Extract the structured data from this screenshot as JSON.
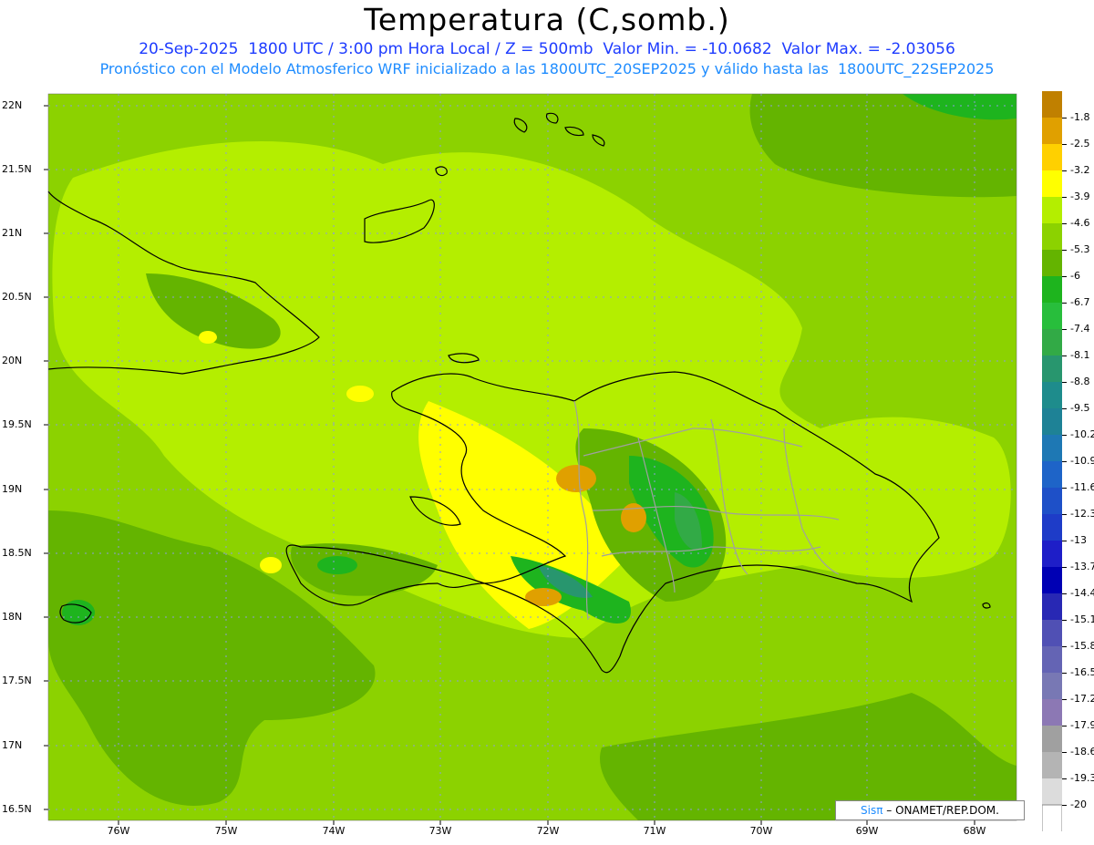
{
  "header": {
    "title": "Temperatura (C,somb.)",
    "subtitle1": "20-Sep-2025  1800 UTC / 3:00 pm Hora Local / Z = 500mb  Valor Min. = -10.0682  Valor Max. = -2.03056",
    "subtitle2": "Pronóstico con el Modelo Atmosferico WRF inicializado a las 1800UTC_20SEP2025 y válido hasta las  1800UTC_22SEP2025"
  },
  "axes": {
    "lat_labels": [
      "22N",
      "21.5N",
      "21N",
      "20.5N",
      "20N",
      "19.5N",
      "19N",
      "18.5N",
      "18N",
      "17.5N",
      "17N",
      "16.5N"
    ],
    "lon_labels": [
      "76W",
      "75W",
      "74W",
      "73W",
      "72W",
      "71W",
      "70W",
      "69W",
      "68W"
    ]
  },
  "colorbar": {
    "labels": [
      "-1.8",
      "-2.5",
      "-3.2",
      "-3.9",
      "-4.6",
      "-5.3",
      "-6",
      "-6.7",
      "-7.4",
      "-8.1",
      "-8.8",
      "-9.5",
      "-10.2",
      "-10.9",
      "-11.6",
      "-12.3",
      "-13",
      "-13.7",
      "-14.4",
      "-15.1",
      "-15.8",
      "-16.5",
      "-17.2",
      "-17.9",
      "-18.6",
      "-19.3",
      "-20"
    ],
    "colors": [
      "#c08000",
      "#e0a000",
      "#ffd000",
      "#ffff00",
      "#b4ee00",
      "#8cd200",
      "#64b400",
      "#1eb41e",
      "#28be3c",
      "#32aa46",
      "#28966e",
      "#1e8c8c",
      "#1e8296",
      "#1e78b4",
      "#1e64c8",
      "#1e50c8",
      "#1e3cc8",
      "#1e1ec8",
      "#0000b4",
      "#2828b4",
      "#5050b4",
      "#6464b4",
      "#7878b4",
      "#8c78b4",
      "#a0a0a0",
      "#b4b4b4",
      "#dcdcdc",
      "#ffffff"
    ]
  },
  "credit": {
    "logo": "Sisπ",
    "text": " – ONAMET/REP.DOM."
  }
}
